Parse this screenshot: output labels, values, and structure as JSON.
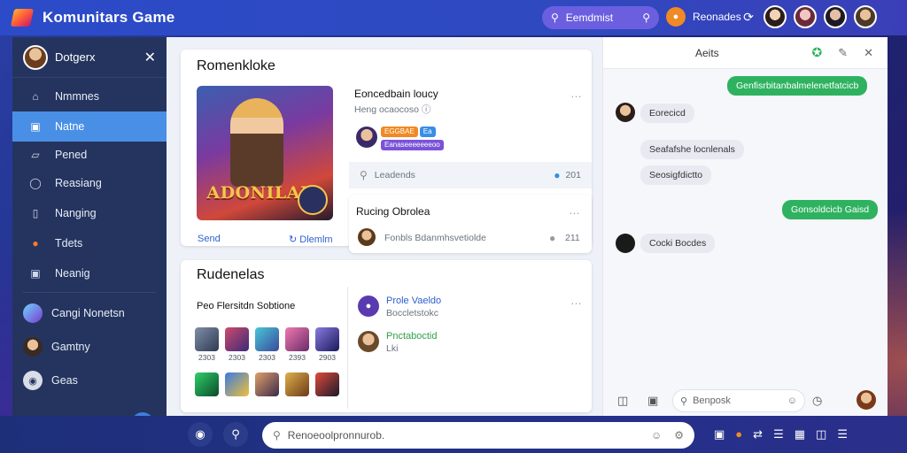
{
  "app": {
    "title": "Komunitars Game"
  },
  "topbar": {
    "search_label": "Eemdmist",
    "user_name": "Reonades",
    "colors": {
      "bar": "#2c4bc9",
      "search": "#6b5fe0",
      "coin": "#f08a24"
    }
  },
  "sidebar": {
    "user": "Dotgerx",
    "items": [
      {
        "label": "Nmmnes",
        "icon": "home-icon"
      },
      {
        "label": "Natne",
        "icon": "lock-icon",
        "active": true
      },
      {
        "label": "Pened",
        "icon": "card-icon"
      },
      {
        "label": "Reasiang",
        "icon": "shield-icon"
      },
      {
        "label": "Nanging",
        "icon": "chat-icon"
      },
      {
        "label": "Tdets",
        "icon": "fire-icon"
      },
      {
        "label": "Neanig",
        "icon": "plus-icon"
      }
    ],
    "groups": [
      {
        "label": "Cangi Nonetsn",
        "icon": "group-avatar-icon"
      },
      {
        "label": "Gamtny",
        "icon": "team-avatar-icon"
      },
      {
        "label": "Geas",
        "icon": "game-avatar-icon"
      }
    ]
  },
  "main": {
    "featured": {
      "heading": "Romenkloke",
      "art_title": "ADONILAIS",
      "link_left": "Send",
      "link_right": "Dlemlm",
      "post_title": "Eoncedbain loucy",
      "post_meta": "Heng ocaocoso",
      "tag": "EGGBAE",
      "tag2": "Eanaseeeeeeeoo",
      "tag_blue": "Ea",
      "reactions_label": "Leadends",
      "reactions_count": "201"
    },
    "trending": {
      "title": "Rucing Obrolea",
      "meta": "Fonbls Bdanmhsvetiolde",
      "count": "211"
    },
    "community": {
      "heading": "Rudenelas",
      "sub": "Peo Flersitdn Sobtione",
      "thumbs_row1": [
        "2303",
        "2303",
        "2303",
        "2393",
        "2903"
      ],
      "colors": {
        "accent": "#2d5fd0"
      }
    },
    "posts": [
      {
        "name": "Prole Vaeldo",
        "meta": "Boccletstokc"
      },
      {
        "name": "Pnctaboctid",
        "meta": "Lki"
      }
    ]
  },
  "chat": {
    "title": "Aeits",
    "messages": [
      {
        "side": "out",
        "text": "Genfisrbitanbalmelenetfatcicb"
      },
      {
        "side": "in",
        "text": "Eorecicd"
      },
      {
        "side": "in",
        "text": "Seafafshe locnlenals"
      },
      {
        "side": "in",
        "text": "Seosigfdictto"
      },
      {
        "side": "out",
        "text": "Gonsoldcicb Gaisd"
      },
      {
        "side": "in",
        "text": "Cocki Bocdes"
      }
    ],
    "input_placeholder": "Benposk",
    "colors": {
      "out": "#2fb260",
      "in": "#e7eaf1"
    }
  },
  "bottombar": {
    "search_placeholder": "Renoeoolpronnurob."
  }
}
